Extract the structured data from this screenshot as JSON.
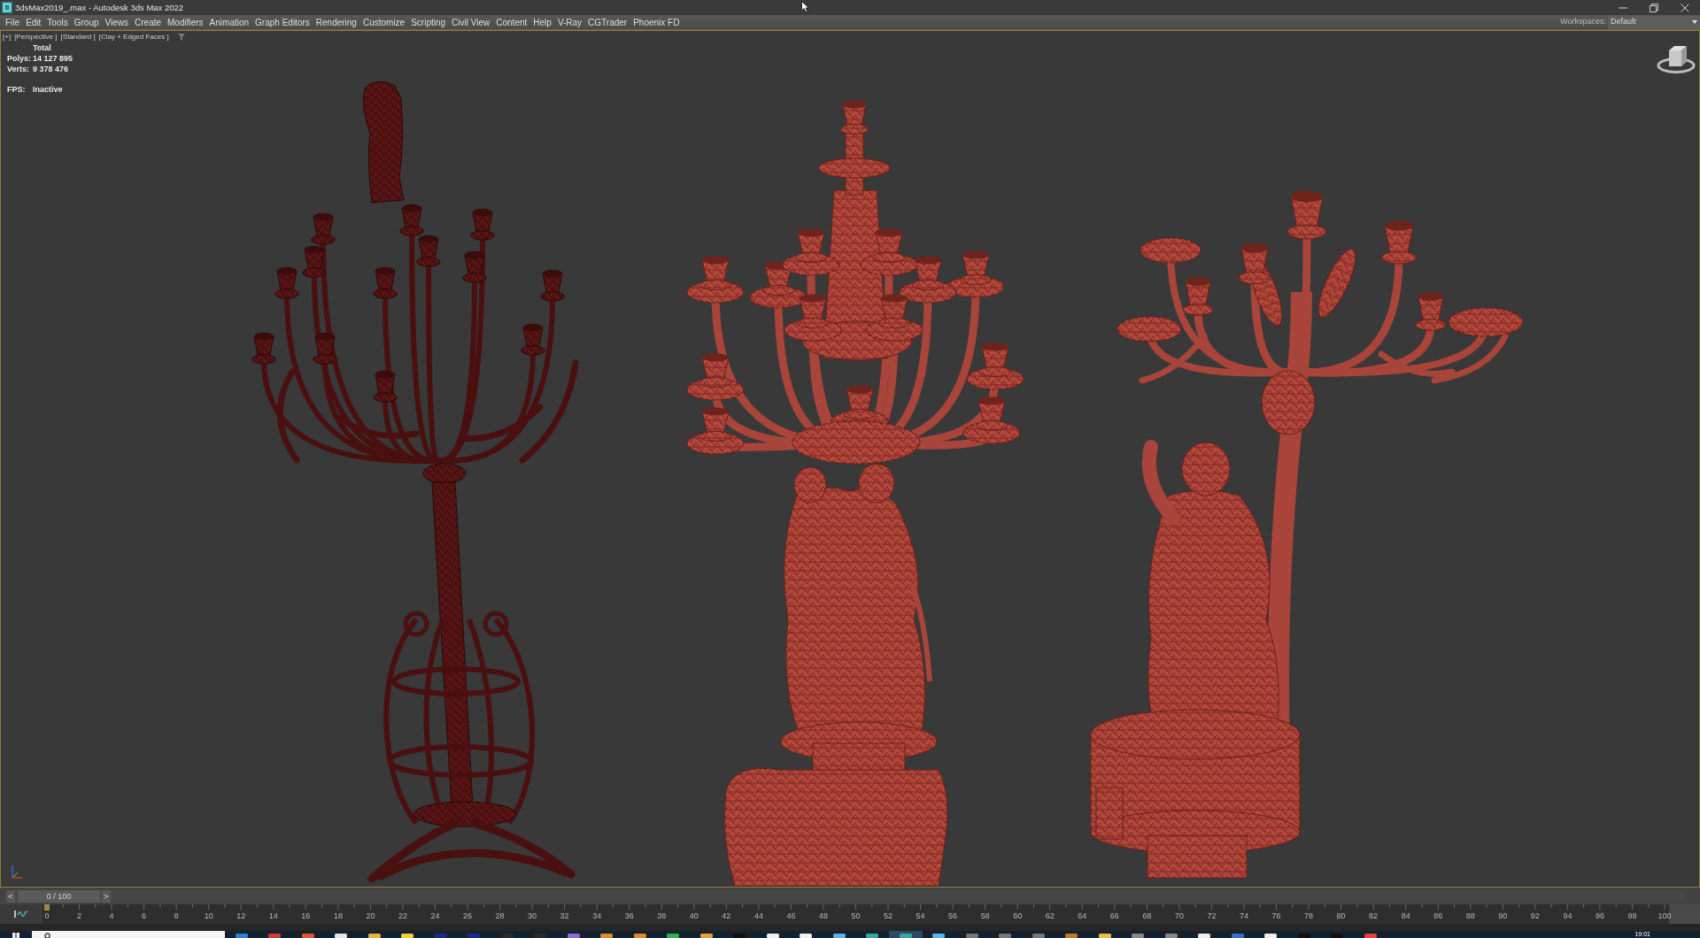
{
  "window": {
    "title": "3dsMax2019_.max - Autodesk 3ds Max 2022"
  },
  "menu_bar": {
    "items": [
      "File",
      "Edit",
      "Tools",
      "Group",
      "Views",
      "Create",
      "Modifiers",
      "Animation",
      "Graph Editors",
      "Rendering",
      "Customize",
      "Scripting",
      "Civil View",
      "Content",
      "Help",
      "V-Ray",
      "CGTrader",
      "Phoenix FD"
    ]
  },
  "workspaces": {
    "label": "Workspaces:",
    "value": "Default"
  },
  "viewport": {
    "labels": [
      "[+]",
      "[Perspective ]",
      "[Standard ]",
      "[Clay + Edged Faces ]"
    ],
    "stats": {
      "heading": "Total",
      "rows": [
        {
          "label": "Polys:",
          "value": "14 127 895"
        },
        {
          "label": "Verts:",
          "value": "9 378 476"
        }
      ]
    },
    "fps": {
      "label": "FPS:",
      "value": "Inactive"
    }
  },
  "time_slider": {
    "previous": "<",
    "frame": "0 / 100",
    "next": ">",
    "level": 0
  },
  "track_bar": {
    "ticks": [
      "0",
      "2",
      "4",
      "6",
      "8",
      "10",
      "12",
      "14",
      "16",
      "18",
      "20",
      "22",
      "24",
      "26",
      "28",
      "30",
      "32",
      "34",
      "36",
      "38",
      "40",
      "42",
      "44",
      "46",
      "48",
      "50",
      "52",
      "54",
      "56",
      "58",
      "60",
      "62",
      "64",
      "66",
      "68",
      "70",
      "72",
      "74",
      "76",
      "78",
      "80",
      "82",
      "84",
      "86",
      "88",
      "90",
      "92",
      "94",
      "96",
      "98",
      "100"
    ]
  },
  "taskbar": {
    "clock": "19:01"
  }
}
